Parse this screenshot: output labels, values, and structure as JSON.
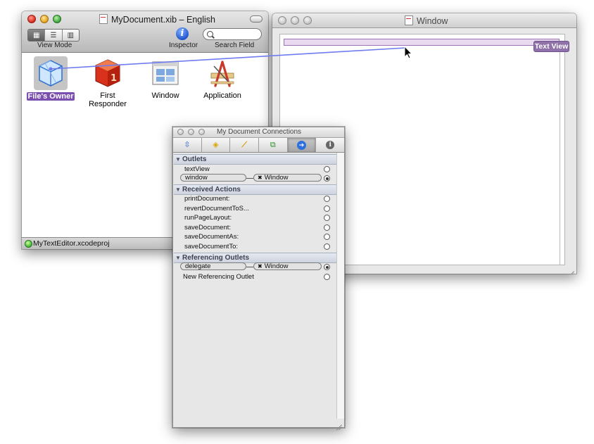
{
  "document_window": {
    "title": "MyDocument.xib – English",
    "toolbar": {
      "view_mode_label": "View Mode",
      "view_mode_segments": [
        "▦",
        "☰",
        "▥"
      ],
      "inspector_label": "Inspector",
      "inspector_glyph": "i",
      "search_label": "Search Field",
      "search_value": ""
    },
    "objects": [
      {
        "label": "File's Owner",
        "icon": "cube-icon",
        "selected": true
      },
      {
        "label": "First Responder",
        "icon": "red-cube-icon"
      },
      {
        "label": "Window",
        "icon": "window-icon"
      },
      {
        "label": "Application",
        "icon": "application-icon"
      }
    ],
    "status_text": "MyTextEditor.xcodeproj"
  },
  "canvas_window": {
    "title": "Window",
    "badge": "Text View"
  },
  "connections_panel": {
    "title": "My Document Connections",
    "tabs": [
      {
        "icon": "attributes-icon",
        "glyph": "⇳"
      },
      {
        "icon": "effects-icon",
        "glyph": "◈"
      },
      {
        "icon": "size-icon",
        "glyph": "⟋"
      },
      {
        "icon": "bindings-icon",
        "glyph": "⧉"
      },
      {
        "icon": "connections-icon",
        "glyph": "➔",
        "active": true
      },
      {
        "icon": "identity-icon",
        "glyph": "i"
      }
    ],
    "sections": {
      "outlets": {
        "title": "Outlets",
        "rows": [
          {
            "name": "textView"
          },
          {
            "name": "window",
            "target": "Window"
          }
        ]
      },
      "received_actions": {
        "title": "Received Actions",
        "rows": [
          {
            "name": "printDocument:"
          },
          {
            "name": "revertDocumentToS..."
          },
          {
            "name": "runPageLayout:"
          },
          {
            "name": "saveDocument:"
          },
          {
            "name": "saveDocumentAs:"
          },
          {
            "name": "saveDocumentTo:"
          }
        ]
      },
      "referencing_outlets": {
        "title": "Referencing Outlets",
        "rows": [
          {
            "name": "delegate",
            "target": "Window"
          },
          {
            "name": "New Referencing Outlet"
          }
        ]
      }
    },
    "connection_mark": "✖"
  },
  "colors": {
    "selection_purple": "#7b4fb0",
    "text_view_highlight": "#eadaf0",
    "connection_line": "#6f7cf0"
  }
}
